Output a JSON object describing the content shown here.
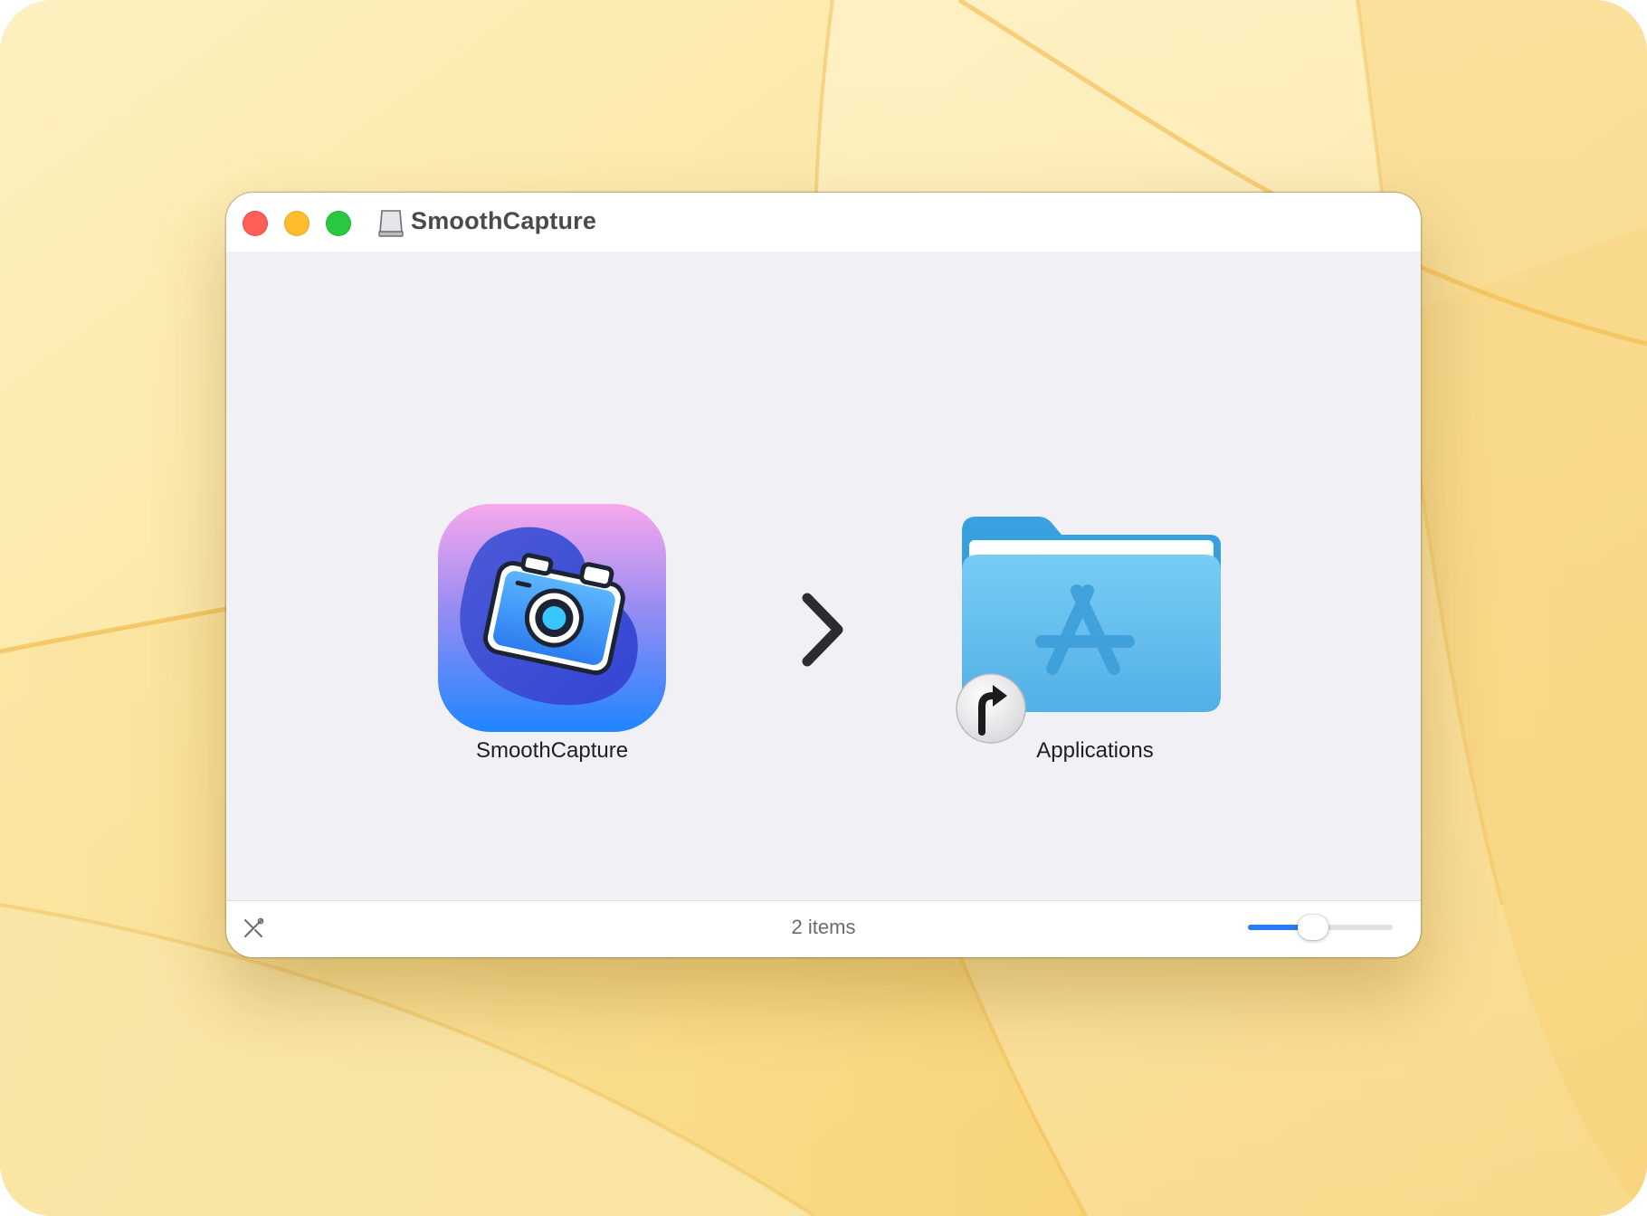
{
  "window": {
    "title": "SmoothCapture"
  },
  "items": [
    {
      "label": "SmoothCapture"
    },
    {
      "label": "Applications"
    }
  ],
  "statusbar": {
    "items_count": "2 items",
    "icon_size_level": 0.45
  },
  "icons": {
    "title": "disk-image-icon",
    "app": "camera-app-icon",
    "folder": "applications-folder-icon",
    "alias": "alias-arrow-icon",
    "arrow": "chevron-right-icon",
    "tools": "tools-icon"
  },
  "colors": {
    "close": "#ff5f57",
    "minimize": "#febc2e",
    "zoom": "#28c840",
    "accent": "#2a7bf6",
    "folder": "#5fbcec"
  }
}
